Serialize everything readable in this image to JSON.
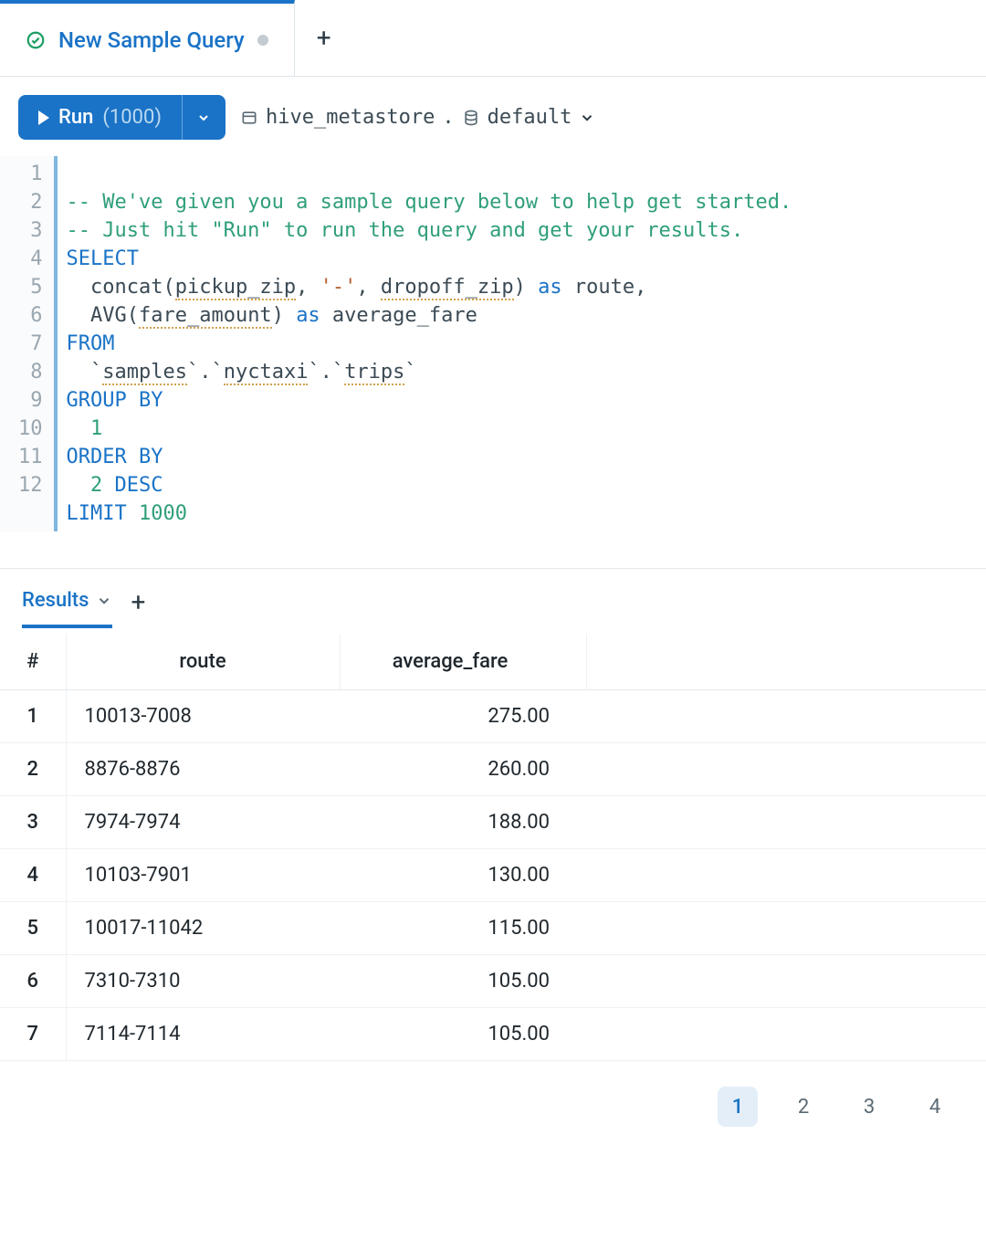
{
  "tabs": {
    "active_title": "New Sample Query"
  },
  "toolbar": {
    "run_label": "Run",
    "run_count": "(1000)",
    "catalog": "hive_metastore",
    "schema": "default"
  },
  "editor": {
    "lines": [
      "1",
      "2",
      "3",
      "4",
      "5",
      "6",
      "7",
      "8",
      "9",
      "10",
      "11",
      "12"
    ],
    "code": {
      "l1": "-- We've given you a sample query below to help get started.",
      "l2": "-- Just hit \"Run\" to run the query and get your results.",
      "l3_select": "SELECT",
      "l4_a": "  concat(",
      "l4_id1": "pickup_zip",
      "l4_b": ", ",
      "l4_str": "'-'",
      "l4_c": ", ",
      "l4_id2": "dropoff_zip",
      "l4_d": ") ",
      "l4_as": "as",
      "l4_e": " route,",
      "l5_a": "  AVG(",
      "l5_id": "fare_amount",
      "l5_b": ") ",
      "l5_as": "as",
      "l5_c": " average_fare",
      "l6": "FROM",
      "l7_a": "  `",
      "l7_id1": "samples",
      "l7_b": "`.`",
      "l7_id2": "nyctaxi",
      "l7_c": "`.`",
      "l7_id3": "trips",
      "l7_d": "`",
      "l8": "GROUP BY",
      "l9": "  1",
      "l10": "ORDER BY",
      "l11_a": "  2 ",
      "l11_b": "DESC",
      "l12_a": "LIMIT",
      "l12_b": " 1000"
    }
  },
  "results": {
    "tab_label": "Results",
    "headers": {
      "idx": "#",
      "route": "route",
      "fare": "average_fare"
    },
    "rows": [
      {
        "n": "1",
        "route": "10013-7008",
        "fare": "275.00"
      },
      {
        "n": "2",
        "route": "8876-8876",
        "fare": "260.00"
      },
      {
        "n": "3",
        "route": "7974-7974",
        "fare": "188.00"
      },
      {
        "n": "4",
        "route": "10103-7901",
        "fare": "130.00"
      },
      {
        "n": "5",
        "route": "10017-11042",
        "fare": "115.00"
      },
      {
        "n": "6",
        "route": "7310-7310",
        "fare": "105.00"
      },
      {
        "n": "7",
        "route": "7114-7114",
        "fare": "105.00"
      }
    ]
  },
  "pager": {
    "pages": [
      "1",
      "2",
      "3",
      "4"
    ],
    "active": "1"
  }
}
